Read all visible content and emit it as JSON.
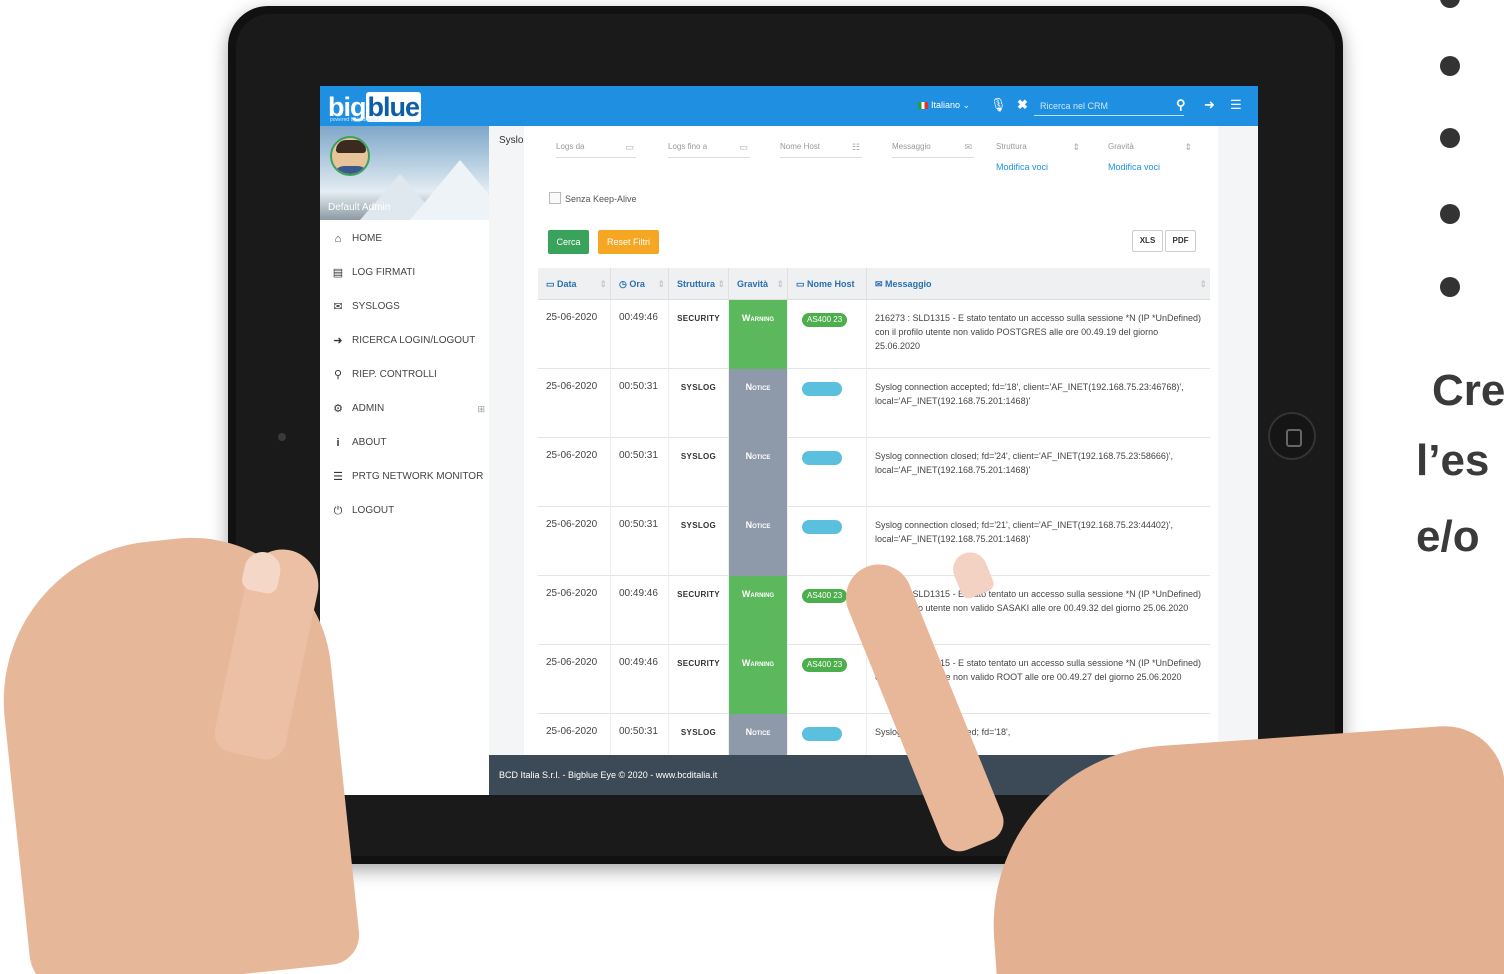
{
  "slide": {
    "text_line1": "Cre",
    "text_line2": "l’es",
    "text_line3": "e/o"
  },
  "app": {
    "logo_main": "big",
    "logo_accent": "blue",
    "logo_tagline": "powered by bcditalia.it",
    "language": "Italiano",
    "crm_search_placeholder": "Ricerca nel CRM",
    "accent_color": "#1e8fe1"
  },
  "sidebar": {
    "user_name": "Default Admin",
    "items": [
      {
        "label": "HOME",
        "icon": "home-icon",
        "glyph": "⌂"
      },
      {
        "label": "LOG FIRMATI",
        "icon": "signed-log-icon",
        "glyph": "▤"
      },
      {
        "label": "SYSLOGS",
        "icon": "envelope-icon",
        "glyph": "✉"
      },
      {
        "label": "RICERCA LOGIN/LOGOUT",
        "icon": "sign-in-icon",
        "glyph": "➜"
      },
      {
        "label": "RIEP. CONTROLLI",
        "icon": "search-icon",
        "glyph": "⚲"
      },
      {
        "label": "ADMIN",
        "icon": "cogs-icon",
        "glyph": "⚙"
      },
      {
        "label": "ABOUT",
        "icon": "info-icon",
        "glyph": "i"
      },
      {
        "label": "PRTG NETWORK MONITOR",
        "icon": "list-icon",
        "glyph": "☰"
      },
      {
        "label": "LOGOUT",
        "icon": "power-icon",
        "glyph": "⏻"
      }
    ],
    "admin_expand": "⊞"
  },
  "main": {
    "page_label": "Syslogs",
    "filters": {
      "logs_from": "Logs da",
      "logs_to": "Logs fino a",
      "host_name": "Nome Host",
      "message": "Messaggio",
      "structure": "Struttura",
      "gravity": "Gravità",
      "edit_items": "Modifica voci"
    },
    "checkbox_label": "Senza Keep-Alive",
    "buttons": {
      "search": "Cerca",
      "reset": "Reset Filtri",
      "xls": "XLS",
      "pdf": "PDF"
    },
    "table": {
      "headers": {
        "date": "Data",
        "time": "Ora",
        "structure": "Struttura",
        "gravity": "Gravità",
        "host": "Nome Host",
        "message": "Messaggio"
      },
      "rows": [
        {
          "date": "25-06-2020",
          "time": "00:49:46",
          "structure": "SECURITY",
          "gravity": "Warning",
          "gravity_color": "#5cb85c",
          "host": "AS400 23",
          "host_color": "#4cae4c",
          "message": "216273 : SLD1315 - E stato tentato un accesso sulla sessione *N (IP *UnDefined) con il profilo utente non valido POSTGRES alle ore 00.49.19 del giorno 25.06.2020"
        },
        {
          "date": "25-06-2020",
          "time": "00:50:31",
          "structure": "SYSLOG",
          "gravity": "Notice",
          "gravity_color": "#8e9aaa",
          "host": "",
          "host_color": "#5bc0de",
          "message": "Syslog connection accepted; fd='18', client='AF_INET(192.168.75.23:46768)', local='AF_INET(192.168.75.201:1468)'"
        },
        {
          "date": "25-06-2020",
          "time": "00:50:31",
          "structure": "SYSLOG",
          "gravity": "Notice",
          "gravity_color": "#8e9aaa",
          "host": "",
          "host_color": "#5bc0de",
          "message": "Syslog connection closed; fd='24', client='AF_INET(192.168.75.23:58666)', local='AF_INET(192.168.75.201:1468)'"
        },
        {
          "date": "25-06-2020",
          "time": "00:50:31",
          "structure": "SYSLOG",
          "gravity": "Notice",
          "gravity_color": "#8e9aaa",
          "host": "",
          "host_color": "#5bc0de",
          "message": "Syslog connection closed; fd='21', client='AF_INET(192.168.75.23:44402)', local='AF_INET(192.168.75.201:1468)'"
        },
        {
          "date": "25-06-2020",
          "time": "00:49:46",
          "structure": "SECURITY",
          "gravity": "Warning",
          "gravity_color": "#5cb85c",
          "host": "AS400 23",
          "host_color": "#4cae4c",
          "message": "216277 : SLD1315 - E stato tentato un accesso sulla sessione *N (IP *UnDefined) con il profilo utente non valido SASAKI alle ore 00.49.32 del giorno 25.06.2020"
        },
        {
          "date": "25-06-2020",
          "time": "00:49:46",
          "structure": "SECURITY",
          "gravity": "Warning",
          "gravity_color": "#5cb85c",
          "host": "AS400 23",
          "host_color": "#4cae4c",
          "message": "216276 : SLD1315 - E stato tentato un accesso sulla sessione *N (IP *UnDefined) con il profilo utente non valido ROOT alle ore 00.49.27 del giorno 25.06.2020"
        },
        {
          "date": "25-06-2020",
          "time": "00:50:31",
          "structure": "SYSLOG",
          "gravity": "Notice",
          "gravity_color": "#8e9aaa",
          "host": "",
          "host_color": "#5bc0de",
          "message": "Syslog connection closed; fd='18',"
        }
      ]
    },
    "footer": "BCD Italia S.r.l. - Bigblue Eye © 2020 - www.bcditalia.it"
  }
}
